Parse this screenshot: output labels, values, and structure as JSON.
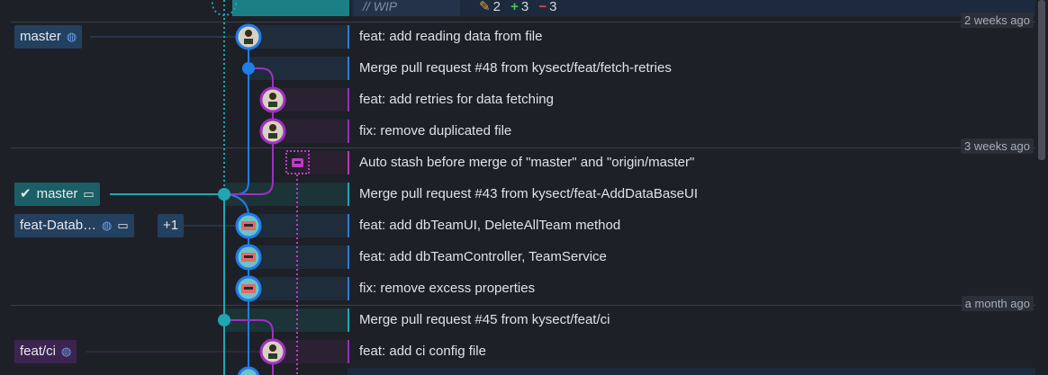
{
  "wip": {
    "placeholder": "// WIP",
    "edited": "2",
    "added": "3",
    "removed": "3"
  },
  "time_markers": [
    "2 weeks ago",
    "3 weeks ago",
    "a month ago"
  ],
  "branches": {
    "master_remote": {
      "label": "master"
    },
    "master_local": {
      "label": "master"
    },
    "feat_db": {
      "label": "feat-Datab…",
      "extra": "+1"
    },
    "feat_ci": {
      "label": "feat/ci"
    }
  },
  "commits": [
    {
      "message": "feat: add reading data from file"
    },
    {
      "message": "Merge pull request #48 from kysect/feat/fetch-retries"
    },
    {
      "message": "feat: add retries for data fetching"
    },
    {
      "message": "fix: remove duplicated file"
    },
    {
      "message": "Auto stash before merge of \"master\" and \"origin/master\""
    },
    {
      "message": "Merge pull request #43 from kysect/feat-AddDataBaseUI"
    },
    {
      "message": "feat: add dbTeamUI, DeleteAllTeam method"
    },
    {
      "message": "feat: add dbTeamController, TeamService"
    },
    {
      "message": "fix: remove excess properties"
    },
    {
      "message": "Merge pull request #45 from kysect/feat/ci"
    },
    {
      "message": "feat: add ci config file"
    }
  ],
  "colors": {
    "teal": "#1ea7b3",
    "blue": "#1f7ee8",
    "purple": "#a12fc2",
    "magenta": "#c13ac8"
  }
}
